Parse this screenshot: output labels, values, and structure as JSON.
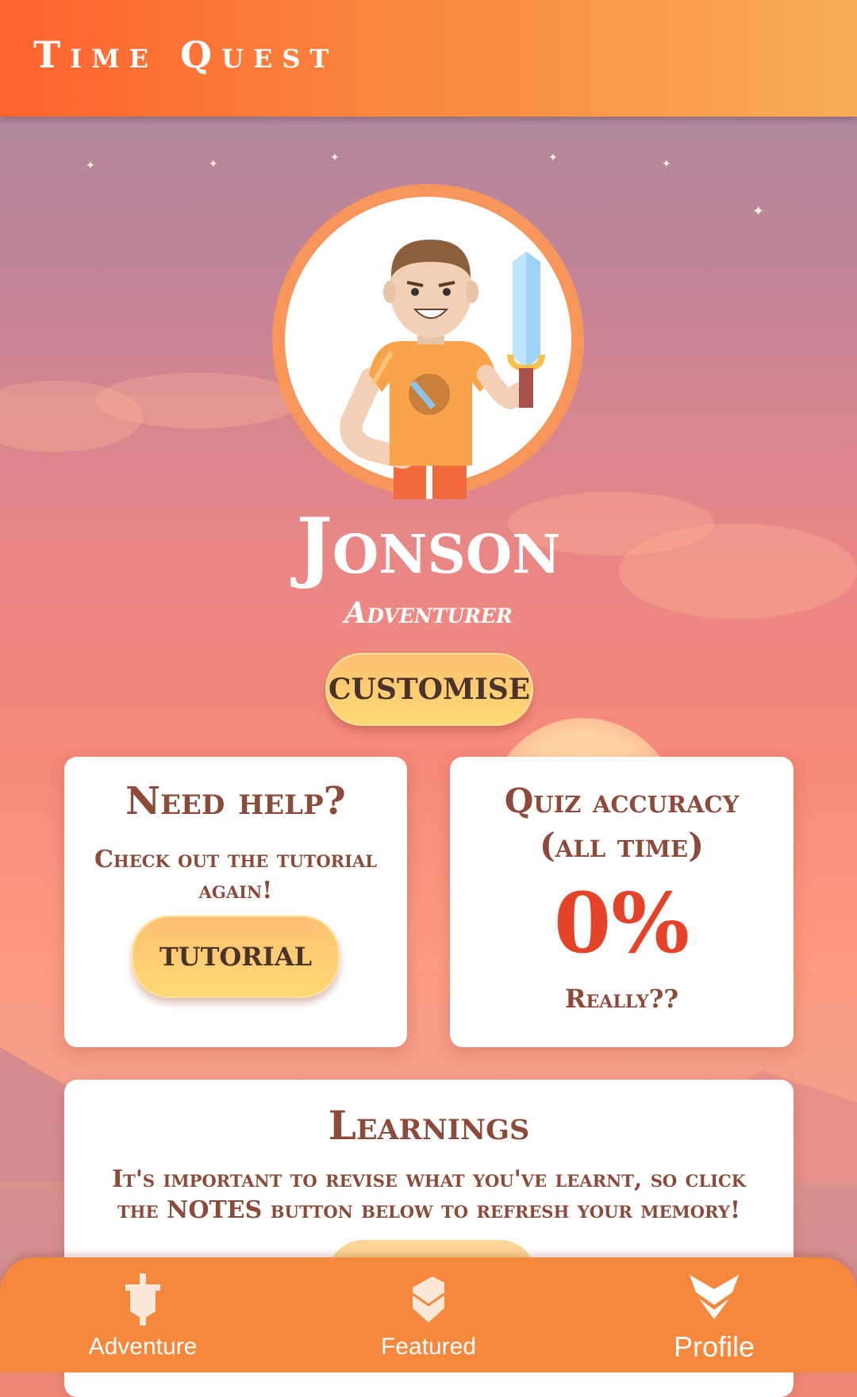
{
  "app": {
    "title": "Time Quest"
  },
  "profile": {
    "name": "Jonson",
    "rank": "Adventurer",
    "customise_label": "CUSTOMISE"
  },
  "help_card": {
    "title": "Need help?",
    "text": "Check out the tutorial again!",
    "button_label": "TUTORIAL"
  },
  "quiz_card": {
    "title": "Quiz accuracy (all time)",
    "value": "0%",
    "caption": "Really??"
  },
  "learnings_card": {
    "title": "Learnings",
    "text": "It's important to revise what you've learnt, so click the NOTES button below to refresh your memory!"
  },
  "bottom_nav": {
    "items": [
      {
        "label": "Adventure",
        "icon": "banner-sword-icon",
        "active": false
      },
      {
        "label": "Featured",
        "icon": "book-icon",
        "active": false
      },
      {
        "label": "Profile",
        "icon": "helmet-icon",
        "active": true
      }
    ]
  },
  "colors": {
    "accent": "#f6883e",
    "title_brown": "#8b4a3a",
    "accuracy_red": "#e4432a",
    "button_yellow": "#ffd974"
  }
}
